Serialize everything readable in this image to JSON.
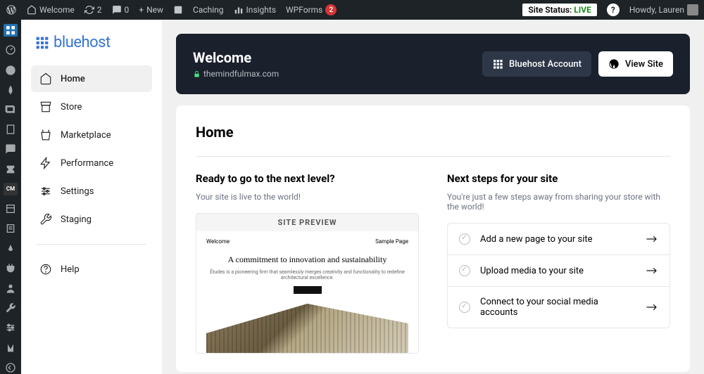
{
  "adminbar": {
    "site_name": "Welcome",
    "updates": "2",
    "comments": "0",
    "new": "New",
    "caching": "Caching",
    "insights": "Insights",
    "wpforms": "WPForms",
    "wpforms_count": "2",
    "site_status_label": "Site Status:",
    "site_status_value": "LIVE",
    "howdy": "Howdy, Lauren"
  },
  "logo": "bluehost",
  "nav": {
    "home": "Home",
    "store": "Store",
    "marketplace": "Marketplace",
    "performance": "Performance",
    "settings": "Settings",
    "staging": "Staging",
    "help": "Help"
  },
  "hero": {
    "title": "Welcome",
    "url": "themindfulmax.com",
    "account_btn": "Bluehost Account",
    "view_btn": "View Site"
  },
  "card": {
    "title": "Home",
    "ready_title": "Ready to go to the next level?",
    "ready_sub": "Your site is live to the world!",
    "preview_label": "SITE PREVIEW",
    "preview_nav_left": "Welcome",
    "preview_nav_right": "Sample Page",
    "preview_heading": "A commitment to innovation and sustainability",
    "preview_sub": "Études is a pioneering firm that seamlessly merges creativity and functionality to redefine architectural excellence.",
    "next_title": "Next steps for your site",
    "next_sub": "You're just a few steps away from sharing your store with the world!",
    "steps": [
      "Add a new page to your site",
      "Upload media to your site",
      "Connect to your social media accounts"
    ]
  }
}
